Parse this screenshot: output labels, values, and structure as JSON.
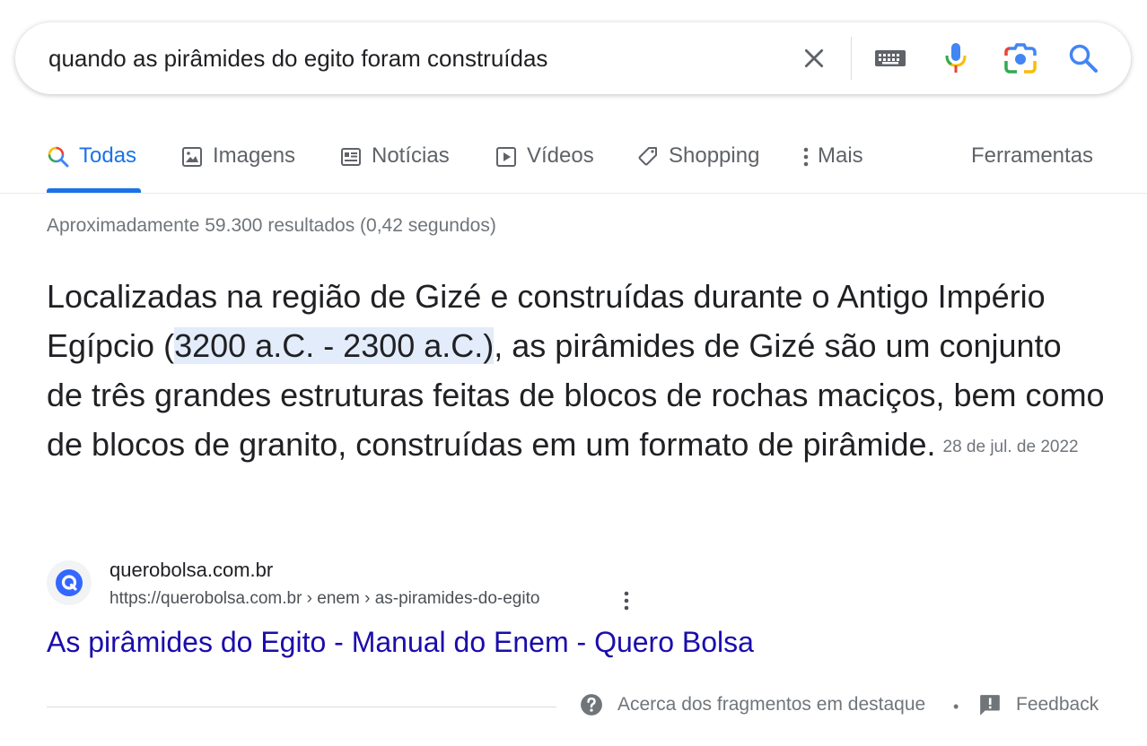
{
  "search": {
    "query": "quando as pirâmides do egito foram construídas"
  },
  "tabs": [
    {
      "label": "Todas",
      "icon": "search-multicolor-icon",
      "active": true
    },
    {
      "label": "Imagens",
      "icon": "image-icon"
    },
    {
      "label": "Notícias",
      "icon": "news-icon"
    },
    {
      "label": "Vídeos",
      "icon": "play-video-icon"
    },
    {
      "label": "Shopping",
      "icon": "tag-icon"
    },
    {
      "label": "Mais",
      "icon": "more-vert-icon"
    }
  ],
  "tools_label": "Ferramentas",
  "result_stats": "Aproximadamente 59.300 resultados (0,42 segundos)",
  "snippet": {
    "before": "Localizadas na região de Gizé e construídas durante o Antigo Império Egípcio (",
    "highlight": "3200 a.C. - 2300 a.C.)",
    "after": ", as pirâmides de Gizé são um conjunto de três grandes estruturas feitas de blocos de rochas maciços, bem como de blocos de granito, construídas em um formato de pirâmide.",
    "date": "28 de jul. de 2022"
  },
  "source": {
    "site_name": "querobolsa.com.br",
    "url": "https://querobolsa.com.br › enem › as-piramides-do-egito",
    "title": "As pirâmides do Egito - Manual do Enem - Quero Bolsa"
  },
  "footer": {
    "about": "Acerca dos fragmentos em destaque",
    "separator": "•",
    "feedback": "Feedback"
  },
  "colors": {
    "accent": "#1a73e8",
    "link": "#1a0dab",
    "highlight": "#e3ecfa",
    "favicon": "#3367ff"
  }
}
